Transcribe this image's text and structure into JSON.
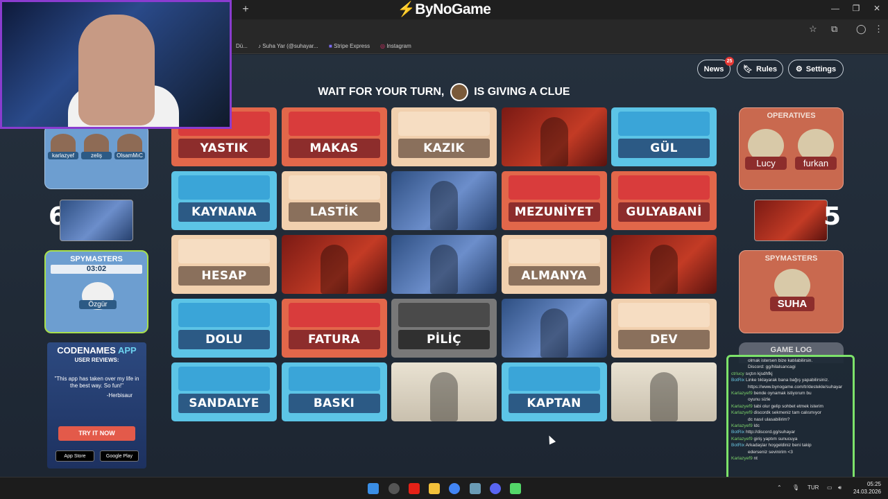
{
  "browser": {
    "logo": "ByNoGame",
    "new_tab": "+",
    "bookmarks": [
      "Dü...",
      "Suha Yar (@suhayar...",
      "Stripe Express",
      "Instagram"
    ]
  },
  "header": {
    "news_label": "News",
    "news_count": "25",
    "rules_label": "Rules",
    "settings_label": "Settings"
  },
  "status": {
    "before": "WAIT FOR YOUR TURN,",
    "avatar_name": "Özgür",
    "after": "IS GIVING A CLUE"
  },
  "board": {
    "cards": [
      {
        "type": "red",
        "word": "YASTIK"
      },
      {
        "type": "red",
        "word": "MAKAS"
      },
      {
        "type": "tan",
        "word": "KAZIK"
      },
      {
        "type": "pic-red",
        "word": ""
      },
      {
        "type": "blue",
        "word": "GÜL"
      },
      {
        "type": "blue",
        "word": "KAYNANA"
      },
      {
        "type": "tan",
        "word": "LASTİK"
      },
      {
        "type": "pic-blue",
        "word": ""
      },
      {
        "type": "red",
        "word": "MEZUNİYET"
      },
      {
        "type": "red",
        "word": "GULYABANİ"
      },
      {
        "type": "tan",
        "word": "HESAP"
      },
      {
        "type": "pic-red",
        "word": ""
      },
      {
        "type": "pic-blue",
        "word": ""
      },
      {
        "type": "tan",
        "word": "ALMANYA"
      },
      {
        "type": "pic-red",
        "word": ""
      },
      {
        "type": "blue",
        "word": "DOLU"
      },
      {
        "type": "red",
        "word": "FATURA"
      },
      {
        "type": "dark",
        "word": "PİLİÇ"
      },
      {
        "type": "pic-blue",
        "word": ""
      },
      {
        "type": "tan",
        "word": "DEV"
      },
      {
        "type": "blue",
        "word": "SANDALYE"
      },
      {
        "type": "blue",
        "word": "BASKI"
      },
      {
        "type": "pic-tan",
        "word": ""
      },
      {
        "type": "blue",
        "word": "KAPTAN"
      },
      {
        "type": "pic-tan",
        "word": ""
      }
    ]
  },
  "blue_team": {
    "operatives": [
      "karlazyef",
      "zeliş",
      "OlsamMıC"
    ],
    "score": "6",
    "spymasters_title": "SPYMASTERS",
    "timer": "03:02",
    "spymaster": "Özgür"
  },
  "red_team": {
    "operatives_title": "OPERATIVES",
    "operatives": [
      "Lucy",
      "furkan"
    ],
    "score": "5",
    "spymasters_title": "SPYMASTERS",
    "spymaster": "SUHA"
  },
  "app_ad": {
    "title_a": "CODENAMES",
    "title_b": "APP",
    "subtitle": "USER REVIEWS:",
    "quote": "\"This app has taken over my life in the best way. So fun!\"",
    "author": "-Herbisaur",
    "cta": "TRY IT NOW",
    "app_store": "App Store",
    "google_play": "Google Play"
  },
  "game_log": "GAME LOG",
  "chat": [
    {
      "user": "",
      "msg": "olmak istersen bize katılabilirsin."
    },
    {
      "user": "",
      "msg": "Discord: gg/hilalsancagi"
    },
    {
      "user": "ctrlucy",
      "msg": "sıçtın kjsdhfkj"
    },
    {
      "user": "BotRix",
      "msg": "Linke tıklayarak bana bağış yapabilirsiniz."
    },
    {
      "user": "",
      "msg": "https://www.bynogame.com/tr/destekle/suhayar"
    },
    {
      "user": "Karlazyef9",
      "msg": "bende oynamak istiyorum bu"
    },
    {
      "user": "",
      "msg": "oyunu sizle"
    },
    {
      "user": "Karlazyef9",
      "msg": "tabi olur gelip sohbet etmek isterim"
    },
    {
      "user": "Karlazyef9",
      "msg": "discordk sekmeniz tam calısmıyor"
    },
    {
      "user": "",
      "msg": "dc nasıl ulasabilirim?"
    },
    {
      "user": "Karlazyef9",
      "msg": "ldc"
    },
    {
      "user": "BotRix",
      "msg": "http://discord.gg/suhayar"
    },
    {
      "user": "Karlazyef9",
      "msg": "giriş yaptım sunucuya"
    },
    {
      "user": "BotRix",
      "msg": "Arkadaşlar hoşgeldiniz beni takip"
    },
    {
      "user": "",
      "msg": "ederseniz sevinirim <3"
    },
    {
      "user": "Karlazyef9",
      "msg": "nt"
    }
  ],
  "taskbar": {
    "lang": "TUR",
    "time": "05:25",
    "date": "24.03.2026"
  }
}
